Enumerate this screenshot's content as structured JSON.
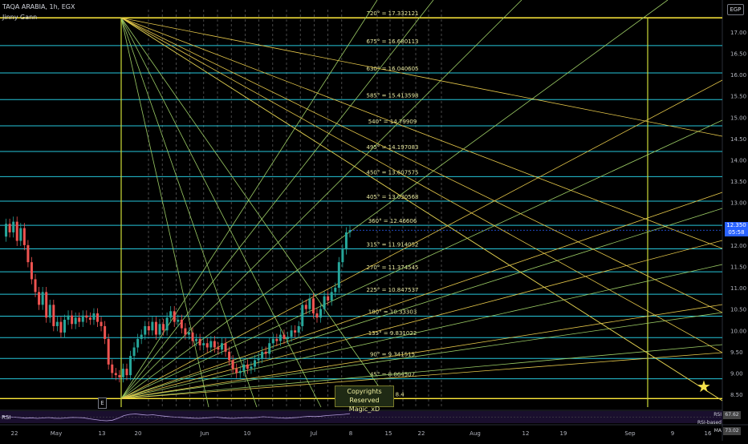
{
  "header": {
    "title": "TAQA ARABIA, 1h, EGX",
    "indicator": "Jinny Gann"
  },
  "currency_badge": "EGP",
  "event_marker": "E",
  "copyright": {
    "line1": "Copyrights Reserved",
    "line2": "Magic_xD"
  },
  "price_tag": {
    "price": "12.350",
    "countdown": "05:58"
  },
  "rsi": {
    "label": "RSI",
    "rsi_key": "RSI",
    "rsi_value": "67.62",
    "ma_key": "RSI-based MA",
    "ma_value": "73.02"
  },
  "colors": {
    "up": "#26a69a",
    "down": "#ef5350",
    "gann_level": "#26c6da",
    "gann_fan": "#cddc39",
    "yellow": "#ffeb3b",
    "star": "#f5e14a"
  },
  "star_icon": "star-icon",
  "chart_data": {
    "type": "candlestick",
    "title": "TAQA ARABIA, 1h, EGX",
    "y_axis": {
      "min": 8.2,
      "max": 17.6,
      "ticks": [
        "8.50",
        "9.00",
        "9.50",
        "10.00",
        "10.50",
        "11.00",
        "11.50",
        "12.00",
        "12.50",
        "13.00",
        "13.50",
        "14.00",
        "14.50",
        "15.00",
        "15.50",
        "16.00",
        "16.50",
        "17.00"
      ],
      "tick_values": [
        8.5,
        9.0,
        9.5,
        10.0,
        10.5,
        11.0,
        11.5,
        12.0,
        12.5,
        13.0,
        13.5,
        14.0,
        14.5,
        15.0,
        15.5,
        16.0,
        16.5,
        17.0
      ],
      "currency": "EGP"
    },
    "x_axis": {
      "labels": [
        "22",
        "May",
        "13",
        "20",
        "Jun",
        "10",
        "Jul",
        "8",
        "15",
        "22",
        "Aug",
        "12",
        "19",
        "Sep",
        "9",
        "16"
      ]
    },
    "gann_levels": [
      {
        "label": "0° = 8.4",
        "value": 8.4
      },
      {
        "label": "45° = 8.864507",
        "value": 8.864507
      },
      {
        "label": "90° = 9.341515",
        "value": 9.341515
      },
      {
        "label": "135° = 9.831022",
        "value": 9.831022
      },
      {
        "label": "180° = 10.33303",
        "value": 10.33303
      },
      {
        "label": "225° = 10.847537",
        "value": 10.847537
      },
      {
        "label": "270° = 11.374545",
        "value": 11.374545
      },
      {
        "label": "315° = 11.914052",
        "value": 11.914052
      },
      {
        "label": "360° = 12.46606",
        "value": 12.46606
      },
      {
        "label": "405° = 13.030568",
        "value": 13.030568
      },
      {
        "label": "450° = 13.607575",
        "value": 13.607575
      },
      {
        "label": "495° = 14.197083",
        "value": 14.197083
      },
      {
        "label": "540° = 14.79909",
        "value": 14.79909
      },
      {
        "label": "585° = 15.413598",
        "value": 15.413598
      },
      {
        "label": "630° = 16.040605",
        "value": 16.040605
      },
      {
        "label": "675° = 16.680113",
        "value": 16.680113
      },
      {
        "label": "720° = 17.332121",
        "value": 17.332121
      }
    ],
    "last_price": 12.35,
    "price_series": [
      12.2,
      12.5,
      12.3,
      12.55,
      12.1,
      12.4,
      12.0,
      11.6,
      11.2,
      10.9,
      10.6,
      10.9,
      10.3,
      10.6,
      10.1,
      10.2,
      9.95,
      10.25,
      10.35,
      10.15,
      10.3,
      10.2,
      10.35,
      10.3,
      10.25,
      10.4,
      10.2,
      10.1,
      9.8,
      9.2,
      9.0,
      8.95,
      8.9,
      9.1,
      8.95,
      9.4,
      9.6,
      9.8,
      9.9,
      10.1,
      10.0,
      10.2,
      9.9,
      10.15,
      10.0,
      10.3,
      10.45,
      10.2,
      10.25,
      10.05,
      9.9,
      9.95,
      9.75,
      9.8,
      9.65,
      9.7,
      9.6,
      9.75,
      9.6,
      9.55,
      9.7,
      9.5,
      9.3,
      9.1,
      9.0,
      9.05,
      9.2,
      9.1,
      9.15,
      9.3,
      9.35,
      9.5,
      9.45,
      9.7,
      9.8,
      9.75,
      9.9,
      9.8,
      9.85,
      10.0,
      9.95,
      10.1,
      10.6,
      10.5,
      10.75,
      10.4,
      10.3,
      10.5,
      10.8,
      10.7,
      10.9,
      11.0,
      11.6,
      11.9,
      12.3,
      12.35
    ],
    "rsi_series": [
      55,
      52,
      50,
      48,
      45,
      47,
      44,
      46,
      48,
      45,
      44,
      46,
      49,
      48,
      47,
      42,
      38,
      34,
      32,
      35,
      45,
      58,
      64,
      66,
      63,
      60,
      62,
      58,
      55,
      52,
      50,
      49,
      47,
      45,
      44,
      46,
      48,
      50,
      47,
      45,
      44,
      46,
      48,
      47,
      49,
      52,
      50,
      48,
      46,
      45,
      47,
      49,
      52,
      54,
      53,
      55,
      58,
      60,
      62,
      64,
      67.62
    ]
  }
}
